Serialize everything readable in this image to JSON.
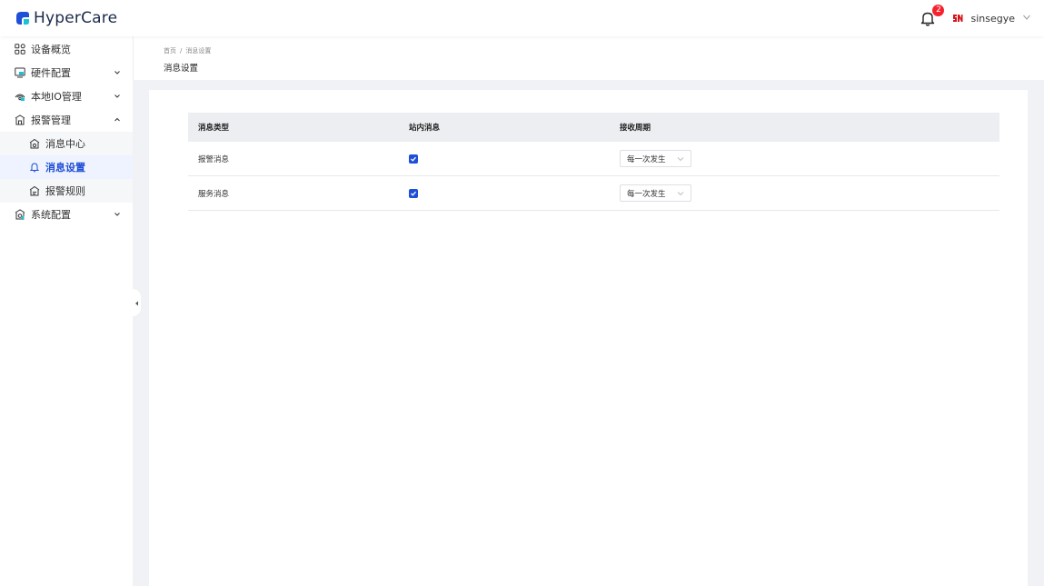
{
  "app": {
    "logo_text": "HyperCare",
    "brand_color": "#1f4fd6",
    "logo_accent": "#17c3d6"
  },
  "header": {
    "notification_count": "2",
    "username": "sinsegye",
    "avatar_text": "SN"
  },
  "sidebar": {
    "items": [
      {
        "label": "设备概览",
        "icon": "grid-icon"
      },
      {
        "label": "硬件配置",
        "icon": "monitor-icon"
      },
      {
        "label": "本地IO管理",
        "icon": "io-icon"
      },
      {
        "label": "报警管理",
        "icon": "alarm-house-icon"
      },
      {
        "label": "系统配置",
        "icon": "system-gear-icon"
      }
    ],
    "sub_items": [
      {
        "label": "消息中心",
        "icon": "message-gear-icon"
      },
      {
        "label": "消息设置",
        "icon": "bell-icon"
      },
      {
        "label": "报警规则",
        "icon": "rule-gear-icon"
      }
    ]
  },
  "breadcrumb": {
    "home": "首页",
    "separator": "/",
    "current": "消息设置"
  },
  "page": {
    "title": "消息设置"
  },
  "table": {
    "headers": [
      "消息类型",
      "站内消息",
      "接收周期"
    ],
    "rows": [
      {
        "type": "报警消息",
        "in_site": true,
        "period": "每一次发生"
      },
      {
        "type": "服务消息",
        "in_site": true,
        "period": "每一次发生"
      }
    ]
  }
}
